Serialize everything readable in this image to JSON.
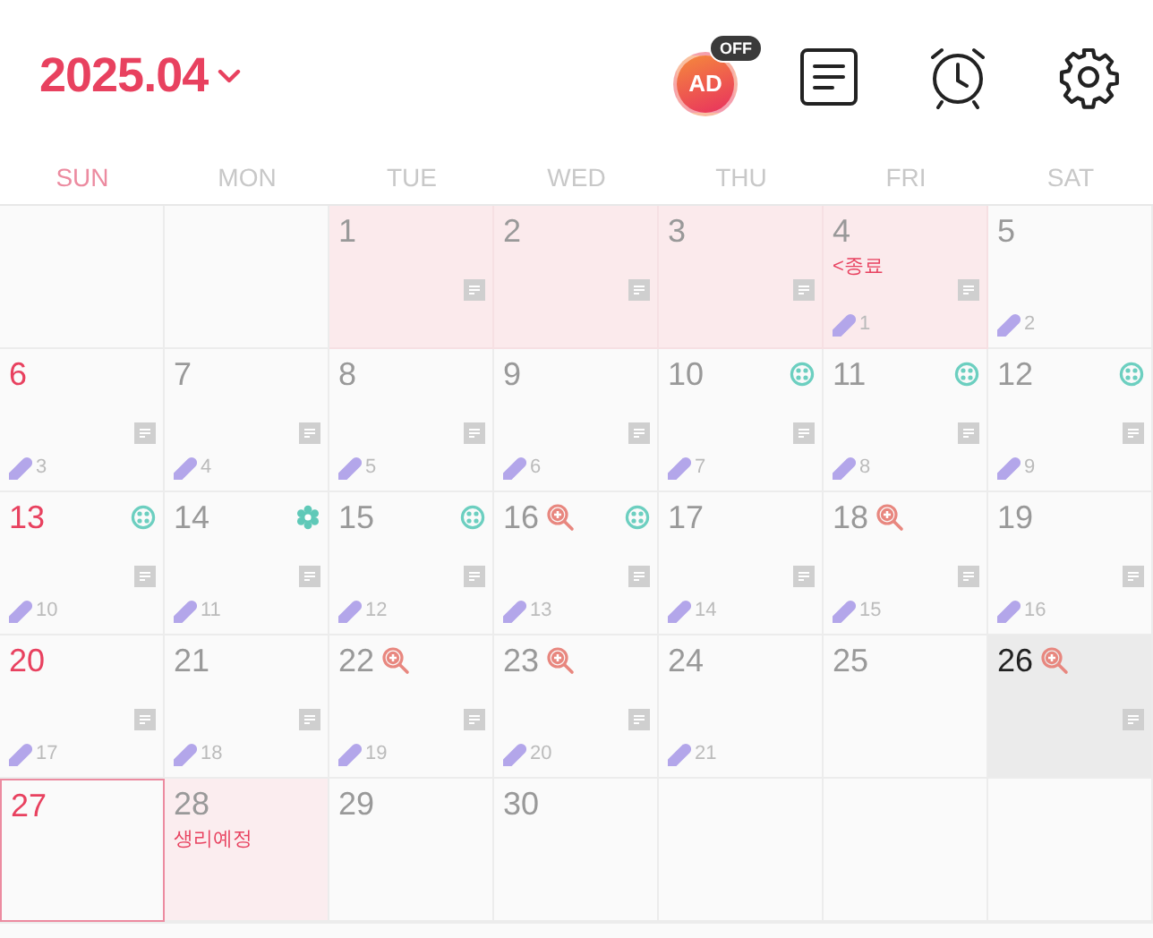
{
  "header": {
    "month": "2025.04",
    "ad_badge": {
      "label": "AD",
      "status": "OFF"
    }
  },
  "weekdays": [
    {
      "label": "SUN",
      "kind": "sunday"
    },
    {
      "label": "MON",
      "kind": "weekday"
    },
    {
      "label": "TUE",
      "kind": "weekday"
    },
    {
      "label": "WED",
      "kind": "weekday"
    },
    {
      "label": "THU",
      "kind": "weekday"
    },
    {
      "label": "FRI",
      "kind": "weekday"
    },
    {
      "label": "SAT",
      "kind": "weekday"
    }
  ],
  "weeks": [
    [
      {
        "kind": "empty"
      },
      {
        "kind": "empty"
      },
      {
        "kind": "day",
        "day": "1",
        "period": true,
        "memo": true
      },
      {
        "kind": "day",
        "day": "2",
        "period": true,
        "memo": true
      },
      {
        "kind": "day",
        "day": "3",
        "period": true,
        "memo": true
      },
      {
        "kind": "day",
        "day": "4",
        "period": true,
        "note": "<종료",
        "memo": true,
        "pill": "1"
      },
      {
        "kind": "day",
        "day": "5",
        "pill": "2"
      }
    ],
    [
      {
        "kind": "day",
        "day": "6",
        "memo": true,
        "pill": "3"
      },
      {
        "kind": "day",
        "day": "7",
        "memo": true,
        "pill": "4"
      },
      {
        "kind": "day",
        "day": "8",
        "memo": true,
        "pill": "5"
      },
      {
        "kind": "day",
        "day": "9",
        "memo": true,
        "pill": "6"
      },
      {
        "kind": "day",
        "day": "10",
        "marker": {
          "kind": "ring"
        },
        "memo": true,
        "pill": "7"
      },
      {
        "kind": "day",
        "day": "11",
        "marker": {
          "kind": "ring"
        },
        "memo": true,
        "pill": "8"
      },
      {
        "kind": "day",
        "day": "12",
        "marker": {
          "kind": "ring"
        },
        "memo": true,
        "pill": "9"
      }
    ],
    [
      {
        "kind": "day",
        "day": "13",
        "marker": {
          "kind": "ring"
        },
        "memo": true,
        "pill": "10"
      },
      {
        "kind": "day",
        "day": "14",
        "marker": {
          "kind": "flower"
        },
        "memo": true,
        "pill": "11"
      },
      {
        "kind": "day",
        "day": "15",
        "marker": {
          "kind": "ring"
        },
        "memo": true,
        "pill": "12"
      },
      {
        "kind": "day",
        "day": "16",
        "zoom": true,
        "marker": {
          "kind": "ring"
        },
        "memo": true,
        "pill": "13"
      },
      {
        "kind": "day",
        "day": "17",
        "memo": true,
        "pill": "14"
      },
      {
        "kind": "day",
        "day": "18",
        "zoom": true,
        "memo": true,
        "pill": "15"
      },
      {
        "kind": "day",
        "day": "19",
        "memo": true,
        "pill": "16"
      }
    ],
    [
      {
        "kind": "day",
        "day": "20",
        "memo": true,
        "pill": "17"
      },
      {
        "kind": "day",
        "day": "21",
        "memo": true,
        "pill": "18"
      },
      {
        "kind": "day",
        "day": "22",
        "zoom": true,
        "memo": true,
        "pill": "19"
      },
      {
        "kind": "day",
        "day": "23",
        "zoom": true,
        "memo": true,
        "pill": "20"
      },
      {
        "kind": "day",
        "day": "24",
        "pill": "21"
      },
      {
        "kind": "day",
        "day": "25"
      },
      {
        "kind": "day",
        "day": "26",
        "zoom": true,
        "selected": true,
        "memo": true
      }
    ],
    [
      {
        "kind": "day",
        "day": "27",
        "today": true
      },
      {
        "kind": "day",
        "day": "28",
        "predicted": true,
        "note": "생리예정"
      },
      {
        "kind": "day",
        "day": "29"
      },
      {
        "kind": "day",
        "day": "30"
      },
      {
        "kind": "empty"
      },
      {
        "kind": "empty"
      },
      {
        "kind": "empty"
      }
    ]
  ]
}
